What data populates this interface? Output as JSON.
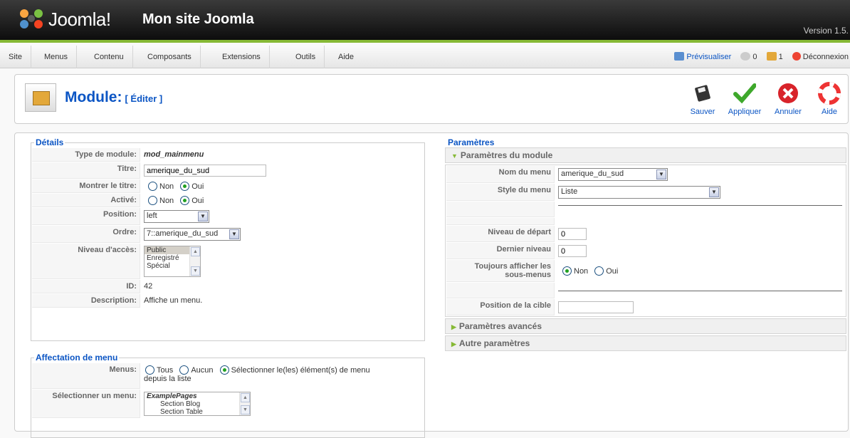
{
  "header": {
    "brand": "Joomla!",
    "site_name": "Mon site Joomla",
    "version": "Version 1.5."
  },
  "menubar": {
    "items": [
      "Site",
      "Menus",
      "Contenu",
      "Composants",
      "Extensions",
      "Outils",
      "Aide"
    ],
    "preview": "Prévisualiser",
    "messages": "0",
    "users": "1",
    "logout": "Déconnexion"
  },
  "toolbar": {
    "title": "Module:",
    "subtitle": "[ Éditer ]",
    "save": "Sauver",
    "apply": "Appliquer",
    "cancel": "Annuler",
    "help": "Aide"
  },
  "details": {
    "legend": "Détails",
    "type_label": "Type de module:",
    "type_value": "mod_mainmenu",
    "title_label": "Titre:",
    "title_value": "amerique_du_sud",
    "show_title_label": "Montrer le titre:",
    "enabled_label": "Activé:",
    "no": "Non",
    "yes": "Oui",
    "position_label": "Position:",
    "position_value": "left",
    "order_label": "Ordre:",
    "order_value": "7::amerique_du_sud",
    "access_label": "Niveau d'accès:",
    "access_options": [
      "Public",
      "Enregistré",
      "Spécial"
    ],
    "id_label": "ID:",
    "id_value": "42",
    "desc_label": "Description:",
    "desc_value": "Affiche un menu."
  },
  "assignment": {
    "legend": "Affectation de menu",
    "menus_label": "Menus:",
    "all": "Tous",
    "none": "Aucun",
    "select_text": "Sélectionner le(les) élément(s) de menu",
    "select_text2": "depuis la liste",
    "select_label": "Sélectionner un menu:",
    "list": [
      "ExamplePages",
      "Section Blog",
      "Section Table"
    ]
  },
  "params": {
    "legend": "Paramètres",
    "module_header": "Paramètres du module",
    "menu_name_label": "Nom du menu",
    "menu_name_value": "amerique_du_sud",
    "menu_style_label": "Style du menu",
    "menu_style_value": "Liste",
    "start_label": "Niveau de départ",
    "start_value": "0",
    "end_label": "Dernier niveau",
    "end_value": "0",
    "always_label_1": "Toujours afficher les",
    "always_label_2": "sous-menus",
    "no": "Non",
    "yes": "Oui",
    "target_label": "Position de la cible",
    "advanced_header": "Paramètres avancés",
    "other_header": "Autre paramètres"
  }
}
